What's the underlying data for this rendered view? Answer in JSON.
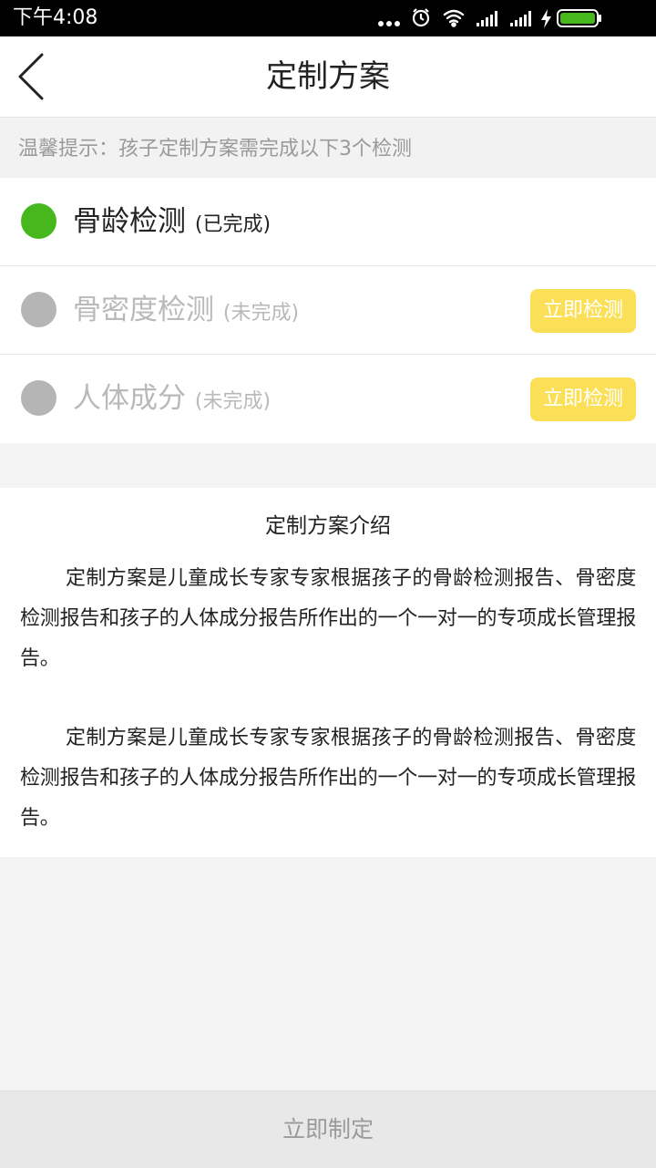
{
  "status_bar": {
    "time": "下午4:08",
    "icons": [
      "more-dots-icon",
      "alarm-icon",
      "wifi-icon",
      "signal-icon",
      "signal-icon",
      "charging-icon",
      "battery-icon"
    ],
    "battery_color": "#46b81d"
  },
  "header": {
    "title": "定制方案",
    "back_icon": "back-arrow-icon"
  },
  "tip": {
    "text": "温馨提示：孩子定制方案需完成以下3个检测"
  },
  "checks": [
    {
      "title": "骨龄检测",
      "status": "(已完成)",
      "done": true,
      "color": "#46b81d"
    },
    {
      "title": "骨密度检测",
      "status": "(未完成)",
      "done": false,
      "button": "立即检测",
      "color": "#b5b5b5"
    },
    {
      "title": "人体成分",
      "status": "(未完成)",
      "done": false,
      "button": "立即检测",
      "color": "#b5b5b5"
    }
  ],
  "intro": {
    "title": "定制方案介绍",
    "paragraphs": [
      "定制方案是儿童成长专家专家根据孩子的骨龄检测报告、骨密度检测报告和孩子的人体成分报告所作出的一个一对一的专项成长管理报告。",
      "定制方案是儿童成长专家专家根据孩子的骨龄检测报告、骨密度检测报告和孩子的人体成分报告所作出的一个一对一的专项成长管理报告。"
    ]
  },
  "footer": {
    "button_label": "立即制定"
  },
  "colors": {
    "button_yellow": "#fbe057",
    "done_green": "#46b81d",
    "todo_gray": "#b5b5b5"
  }
}
